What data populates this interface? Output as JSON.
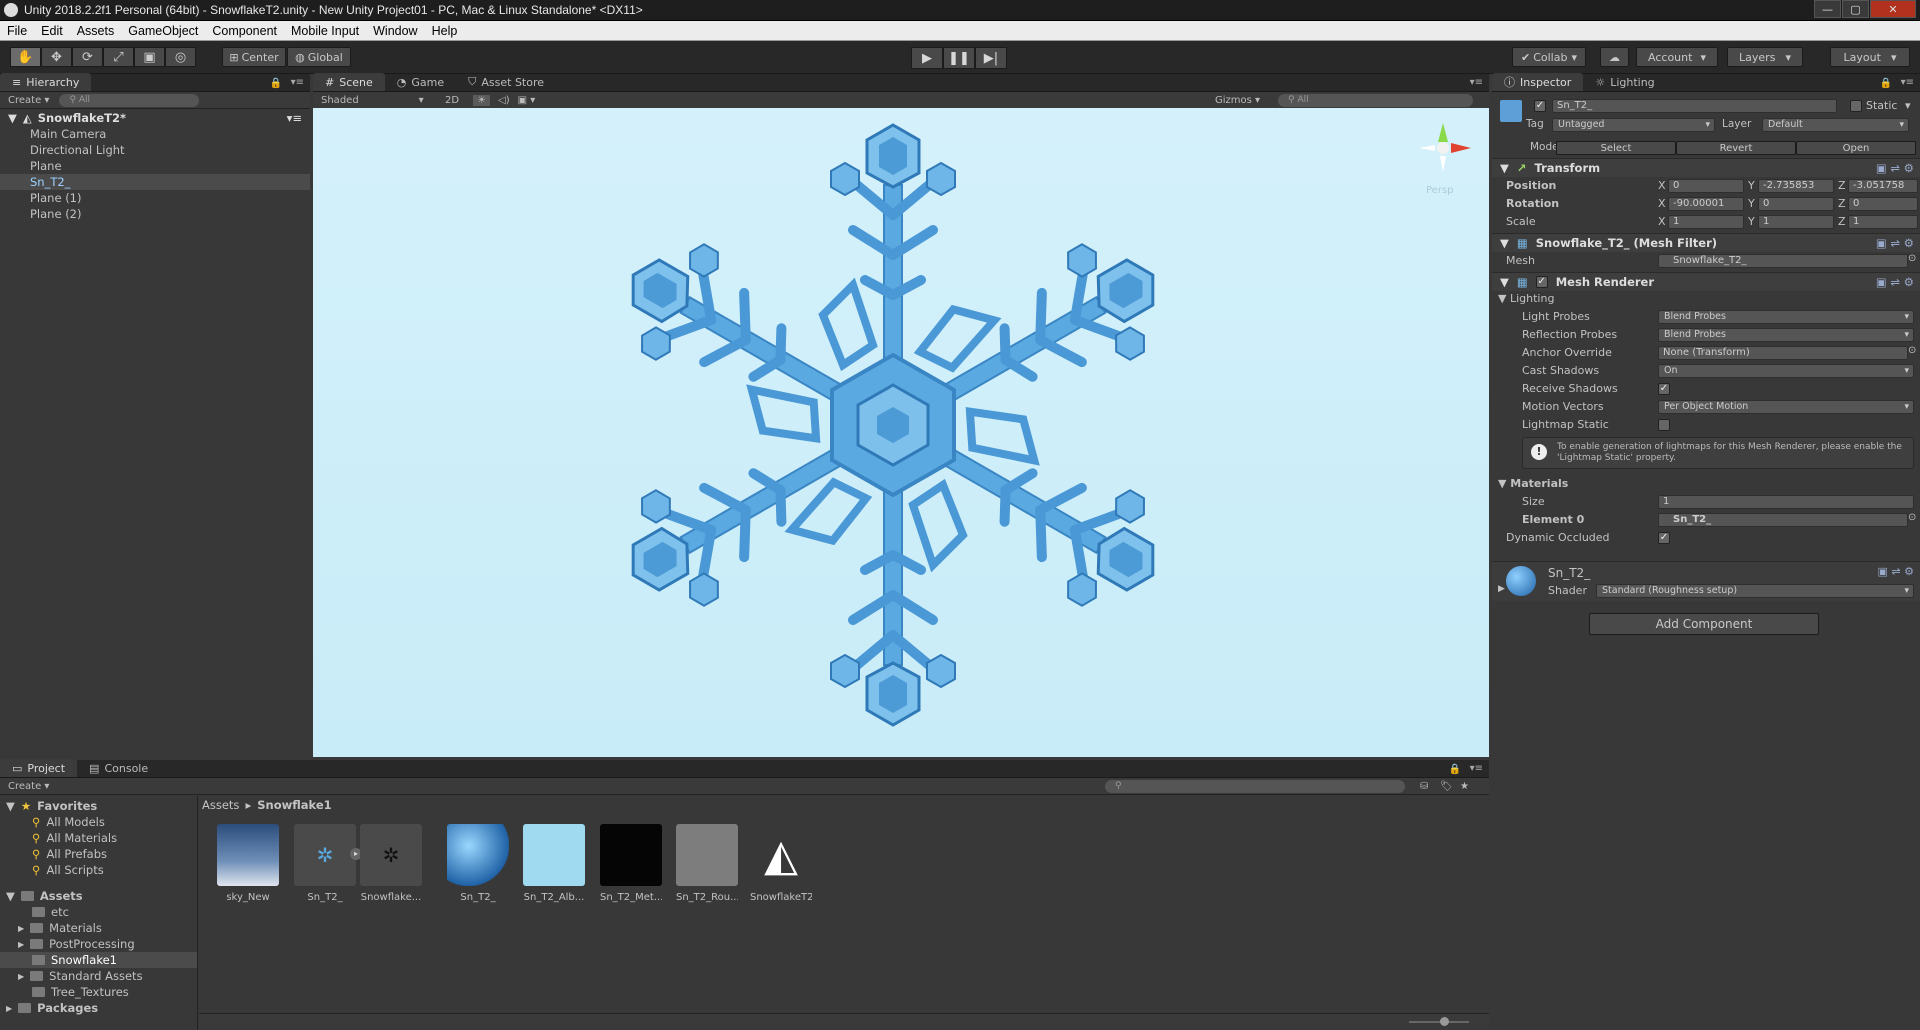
{
  "window": {
    "title": "Unity 2018.2.2f1 Personal (64bit) - SnowflakeT2.unity - New Unity Project01 - PC, Mac & Linux Standalone* <DX11>"
  },
  "menu": [
    "File",
    "Edit",
    "Assets",
    "GameObject",
    "Component",
    "Mobile Input",
    "Window",
    "Help"
  ],
  "toolbar": {
    "center_label": "Center",
    "global_label": "Global",
    "collab_label": "Collab",
    "account_label": "Account",
    "layers_label": "Layers",
    "layout_label": "Layout"
  },
  "hierarchy": {
    "tab": "Hierarchy",
    "create": "Create",
    "search_placeholder": "All",
    "scene_name": "SnowflakeT2*",
    "items": [
      "Main Camera",
      "Directional Light",
      "Plane",
      "Sn_T2_",
      "Plane (1)",
      "Plane (2)"
    ],
    "selected_index": 3
  },
  "scene_view": {
    "tabs": [
      "Scene",
      "Game",
      "Asset Store"
    ],
    "shading": "Shaded",
    "mode_2d": "2D",
    "gizmos": "Gizmos",
    "search_placeholder": "All",
    "persp_label": "Persp"
  },
  "inspector": {
    "tabs": [
      "Inspector",
      "Lighting"
    ],
    "object_name": "Sn_T2_",
    "static_label": "Static",
    "tag_label": "Tag",
    "tag_value": "Untagged",
    "layer_label": "Layer",
    "layer_value": "Default",
    "model_label": "Model",
    "model_buttons": [
      "Select",
      "Revert",
      "Open"
    ],
    "transform": {
      "title": "Transform",
      "position_label": "Position",
      "position": {
        "x": "0",
        "y": "-2.735853",
        "z": "-3.051758"
      },
      "rotation_label": "Rotation",
      "rotation": {
        "x": "-90.00001",
        "y": "0",
        "z": "0"
      },
      "scale_label": "Scale",
      "scale": {
        "x": "1",
        "y": "1",
        "z": "1"
      }
    },
    "mesh_filter": {
      "title": "Snowflake_T2_ (Mesh Filter)",
      "mesh_label": "Mesh",
      "mesh_value": "Snowflake_T2_"
    },
    "mesh_renderer": {
      "title": "Mesh Renderer",
      "lighting_label": "Lighting",
      "light_probes_label": "Light Probes",
      "light_probes": "Blend Probes",
      "reflection_probes_label": "Reflection Probes",
      "reflection_probes": "Blend Probes",
      "anchor_override_label": "Anchor Override",
      "anchor_override": "None (Transform)",
      "cast_shadows_label": "Cast Shadows",
      "cast_shadows": "On",
      "receive_shadows_label": "Receive Shadows",
      "motion_vectors_label": "Motion Vectors",
      "motion_vectors": "Per Object Motion",
      "lightmap_static_label": "Lightmap Static",
      "info_text": "To enable generation of lightmaps for this Mesh Renderer, please enable the 'Lightmap Static' property.",
      "materials_label": "Materials",
      "size_label": "Size",
      "size": "1",
      "element0_label": "Element 0",
      "element0": "Sn_T2_",
      "dynamic_occluded_label": "Dynamic Occluded"
    },
    "material": {
      "name": "Sn_T2_",
      "shader_label": "Shader",
      "shader": "Standard (Roughness setup)"
    },
    "add_component": "Add Component"
  },
  "project": {
    "tabs": [
      "Project",
      "Console"
    ],
    "create": "Create",
    "breadcrumb": [
      "Assets",
      "Snowflake1"
    ],
    "favorites_label": "Favorites",
    "favorites": [
      "All Models",
      "All Materials",
      "All Prefabs",
      "All Scripts"
    ],
    "assets_label": "Assets",
    "folders": [
      "etc",
      "Materials",
      "PostProcessing",
      "Snowflake1",
      "Standard Assets",
      "Tree_Textures"
    ],
    "packages_label": "Packages",
    "asset_items": [
      "sky_New",
      "Sn_T2_",
      "Snowflake...",
      "Sn_T2_",
      "Sn_T2_Alb...",
      "Sn_T2_Met...",
      "Sn_T2_Rou...",
      "SnowflakeT2"
    ]
  },
  "colors": {
    "accent_selection": "#9cd1ff",
    "viewport_bg": "#cdeef9",
    "snowflake": "#5aa9e0"
  }
}
